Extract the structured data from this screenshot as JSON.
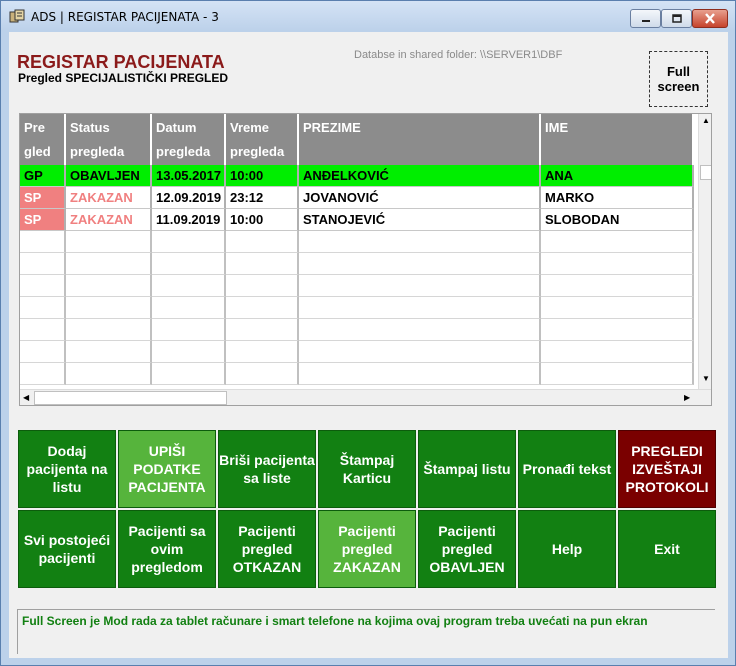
{
  "window": {
    "title": "ADS | REGISTAR PACIJENATA  -  3"
  },
  "header": {
    "title": "REGISTAR PACIJENATA",
    "subtitle": "Pregled SPECIJALISTIČKI PREGLED",
    "db_path": "Databse in shared folder: \\\\SERVER1\\DBF",
    "fullscreen_label": "Full screen"
  },
  "table": {
    "columns": [
      {
        "line1": "Pre",
        "line2": "gled"
      },
      {
        "line1": "Status",
        "line2": "pregleda"
      },
      {
        "line1": "Datum",
        "line2": "pregleda"
      },
      {
        "line1": "Vreme",
        "line2": "pregleda"
      },
      {
        "line1": "PREZIME",
        "line2": ""
      },
      {
        "line1": "IME",
        "line2": ""
      }
    ],
    "rows": [
      {
        "pregled": "GP",
        "status": "OBAVLJEN",
        "datum": "13.05.2017",
        "vreme": "10:00",
        "prezime": "ANĐELKOVIĆ",
        "ime": "ANA",
        "style": "done"
      },
      {
        "pregled": "SP",
        "status": "ZAKAZAN",
        "datum": "12.09.2019",
        "vreme": "23:12",
        "prezime": "JOVANOVIĆ",
        "ime": "MARKO",
        "style": "scheduled"
      },
      {
        "pregled": "SP",
        "status": "ZAKAZAN",
        "datum": "11.09.2019",
        "vreme": "10:00",
        "prezime": "STANOJEVIĆ",
        "ime": "SLOBODAN",
        "style": "scheduled"
      }
    ]
  },
  "buttons": {
    "row1": [
      {
        "label": "Dodaj pacijenta na listu",
        "variant": "normal"
      },
      {
        "label": "UPIŠI PODATKE PACIJENTA",
        "variant": "light"
      },
      {
        "label": "Briši pacijenta sa liste",
        "variant": "normal"
      },
      {
        "label": "Štampaj Karticu",
        "variant": "normal"
      },
      {
        "label": "Štampaj listu",
        "variant": "normal"
      },
      {
        "label": "Pronađi tekst",
        "variant": "normal"
      },
      {
        "label": "PREGLEDI IZVEŠTAJI PROTOKOLI",
        "variant": "dark-red"
      }
    ],
    "row2": [
      {
        "label": "Svi postojeći pacijenti",
        "variant": "normal"
      },
      {
        "label": "Pacijenti sa ovim pregledom",
        "variant": "normal"
      },
      {
        "label": "Pacijenti pregled OTKAZAN",
        "variant": "normal"
      },
      {
        "label": "Pacijenti pregled ZAKAZAN",
        "variant": "light"
      },
      {
        "label": "Pacijenti pregled OBAVLJEN",
        "variant": "normal"
      },
      {
        "label": "Help",
        "variant": "normal"
      },
      {
        "label": "Exit",
        "variant": "normal"
      }
    ]
  },
  "status_bar": {
    "text": "Full Screen je Mod rada za tablet računare i smart telefone na kojima ovaj program treba uvećati na pun ekran"
  },
  "colors": {
    "row_done_bg": "#00ee00",
    "row_scheduled_code_bg": "#f08080",
    "row_scheduled_status_text": "#f08080",
    "button_green": "#128012",
    "button_light_green": "#56b43c",
    "button_dark_red": "#7a0000",
    "title_red": "#8b1a1a"
  },
  "icons": {
    "app": "app-box-icon",
    "minimize": "minimize-icon",
    "maximize": "maximize-icon",
    "close": "close-icon"
  }
}
